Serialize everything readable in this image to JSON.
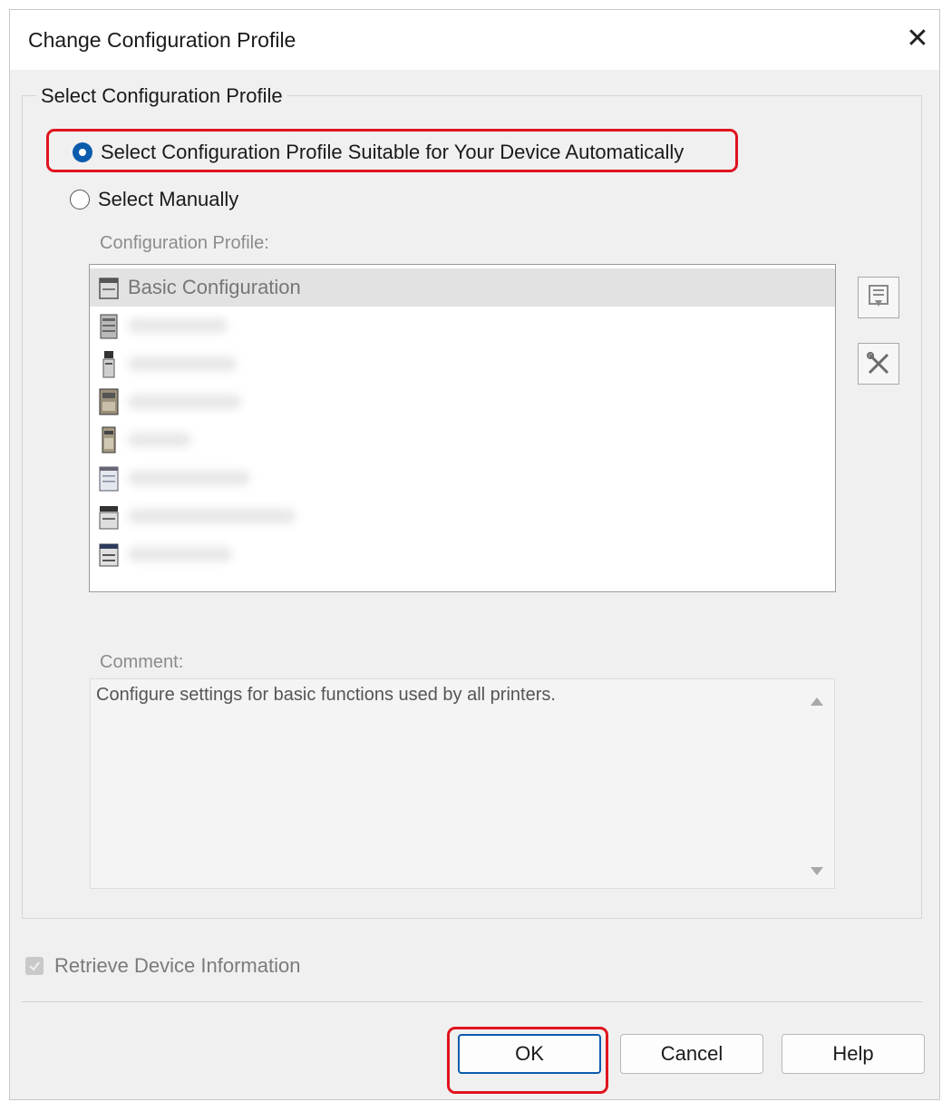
{
  "window": {
    "title": "Change Configuration Profile"
  },
  "group": {
    "legend": "Select Configuration Profile"
  },
  "options": {
    "auto_label": "Select Configuration Profile Suitable for Your Device Automatically",
    "manual_label": "Select Manually",
    "selected": "auto"
  },
  "profile_list": {
    "label": "Configuration Profile:",
    "items": [
      {
        "label": "Basic Configuration",
        "icon": "basic-config-icon",
        "selected": true
      },
      {
        "label": "",
        "icon": "printer-icon"
      },
      {
        "label": "",
        "icon": "printer-icon"
      },
      {
        "label": "",
        "icon": "printer-icon"
      },
      {
        "label": "",
        "icon": "printer-icon"
      },
      {
        "label": "",
        "icon": "printer-icon"
      },
      {
        "label": "",
        "icon": "printer-icon"
      },
      {
        "label": "",
        "icon": "printer-icon"
      }
    ]
  },
  "side_buttons": {
    "import_icon": "import-icon",
    "tools_icon": "tools-icon"
  },
  "comment": {
    "label": "Comment:",
    "text": "Configure settings for basic functions used by all printers."
  },
  "retrieve": {
    "label": "Retrieve Device Information",
    "checked": true,
    "disabled": true
  },
  "buttons": {
    "ok": "OK",
    "cancel": "Cancel",
    "help": "Help"
  },
  "colors": {
    "accent": "#0b5cad",
    "highlight": "#e0141e"
  }
}
